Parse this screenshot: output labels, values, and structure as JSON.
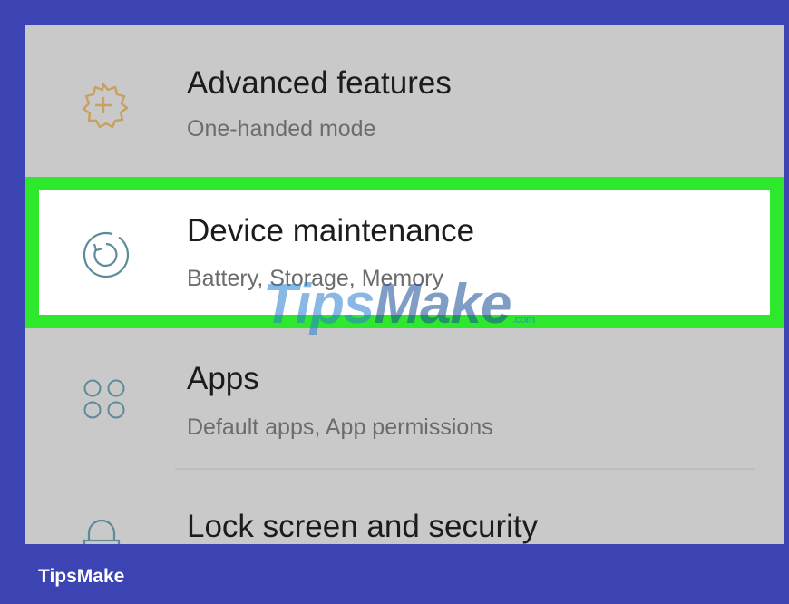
{
  "settings": {
    "items": [
      {
        "title": "Advanced features",
        "subtitle": "One-handed mode",
        "icon": "gear-plus-icon"
      },
      {
        "title": "Device maintenance",
        "subtitle": "Battery, Storage, Memory",
        "icon": "refresh-circle-icon",
        "highlighted": true
      },
      {
        "title": "Apps",
        "subtitle": "Default apps, App permissions",
        "icon": "apps-grid-icon"
      },
      {
        "title": "Lock screen and security",
        "subtitle": "",
        "icon": "lock-icon"
      }
    ]
  },
  "watermark": {
    "part1": "Tips",
    "part2": "Make",
    "suffix": ".com"
  },
  "footer": {
    "brand": "TipsMake"
  },
  "colors": {
    "frame": "#3b44b2",
    "highlight": "#2ee82e",
    "gear_icon": "#c8a060",
    "accent_icon": "#5e8a9a"
  }
}
